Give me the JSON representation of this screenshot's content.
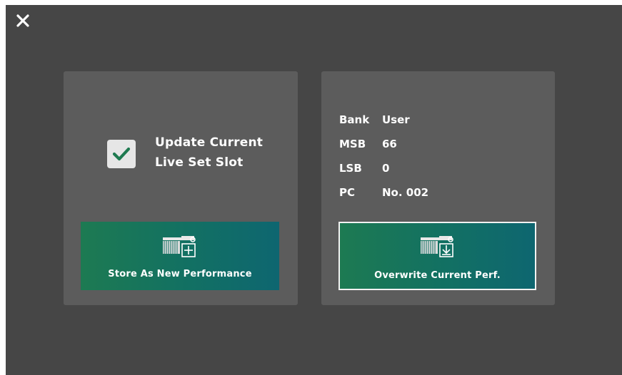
{
  "close": {
    "icon": "close-icon"
  },
  "left_panel": {
    "checkbox": {
      "checked": true,
      "icon": "check-icon"
    },
    "label_line1": "Update Current",
    "label_line2": "Live Set Slot",
    "store_button": {
      "label": "Store As New Performance",
      "icon": "store-new-performance-icon"
    }
  },
  "right_panel": {
    "info": [
      {
        "key": "Bank",
        "value": "User"
      },
      {
        "key": "MSB",
        "value": "66"
      },
      {
        "key": "LSB",
        "value": "0"
      },
      {
        "key": "PC",
        "value": "No. 002"
      }
    ],
    "overwrite_button": {
      "label": "Overwrite Current Perf.",
      "icon": "overwrite-performance-icon"
    }
  },
  "colors": {
    "background": "#464646",
    "panel": "#5c5c5c",
    "check": "#1e7a50",
    "button_gradient_start": "#1d7a52",
    "button_gradient_end": "#0e6670"
  }
}
